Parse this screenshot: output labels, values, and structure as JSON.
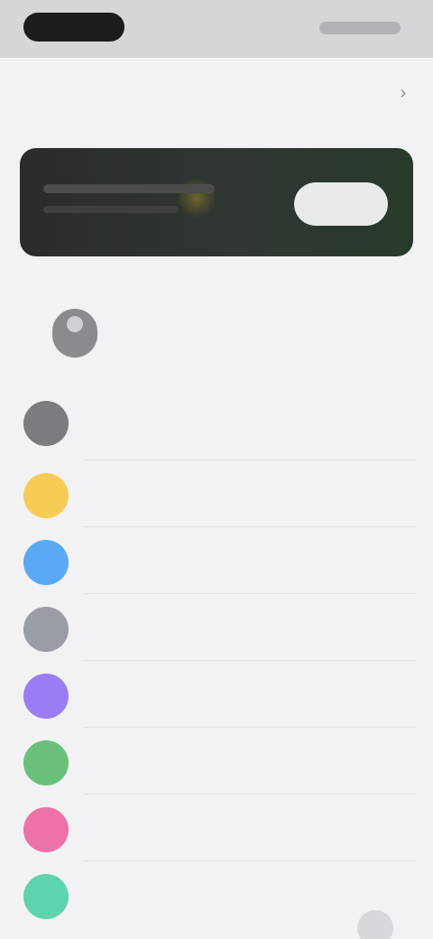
{
  "status_bar": {},
  "nav": {
    "title": "",
    "action_icon": "chevron-icon"
  },
  "banner": {
    "button_label": ""
  },
  "profile": {
    "name": "",
    "subtitle": ""
  },
  "rows": [
    {
      "label": "",
      "value": "",
      "icon_color": "#7b7b80",
      "icon": "gear-icon"
    },
    {
      "label": "",
      "value": "",
      "icon_color": "#f7cc55",
      "icon": "sun-icon"
    },
    {
      "label": "",
      "value": "",
      "icon_color": "#5aa9f5",
      "icon": "globe-icon"
    },
    {
      "label": "",
      "value": "",
      "icon_color": "#9a9ca6",
      "icon": "lock-icon"
    },
    {
      "label": "",
      "value": "",
      "icon_color": "#9a7cf4",
      "icon": "moon-icon"
    },
    {
      "label": "",
      "value": "",
      "icon_color": "#6ac07a",
      "icon": "leaf-icon"
    },
    {
      "label": "",
      "value": "",
      "icon_color": "#ec72a8",
      "icon": "heart-icon"
    },
    {
      "label": "",
      "value": "",
      "icon_color": "#5ed3b0",
      "icon": "chat-icon"
    }
  ],
  "colors": {
    "background": "#f2f2f4",
    "banner": "#2a2c2b"
  }
}
